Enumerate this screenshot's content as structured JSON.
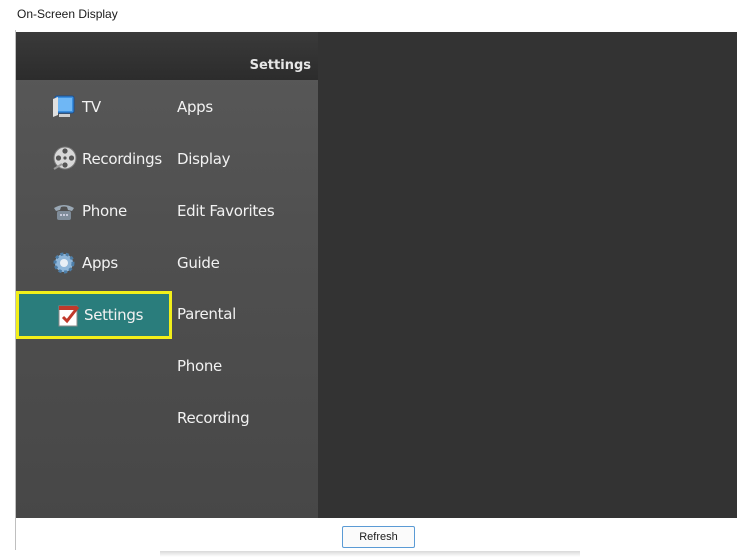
{
  "window": {
    "title": "On-Screen Display"
  },
  "menu": {
    "header_title": "Settings",
    "nav_items": [
      {
        "label": "TV",
        "icon": "tv-icon"
      },
      {
        "label": "Recordings",
        "icon": "film-reel-icon"
      },
      {
        "label": "Phone",
        "icon": "phone-icon"
      },
      {
        "label": "Apps",
        "icon": "gear-icon"
      },
      {
        "label": "Settings",
        "icon": "settings-checklist-icon",
        "selected": true
      }
    ],
    "sub_items": [
      "Apps",
      "Display",
      "Edit Favorites",
      "Guide",
      "Parental",
      "Phone",
      "Recording"
    ]
  },
  "footer": {
    "refresh_label": "Refresh"
  },
  "colors": {
    "selected_bg": "#2a7d7c",
    "selected_border": "#f2ef1a",
    "panel": "#505050",
    "content": "#333333"
  }
}
